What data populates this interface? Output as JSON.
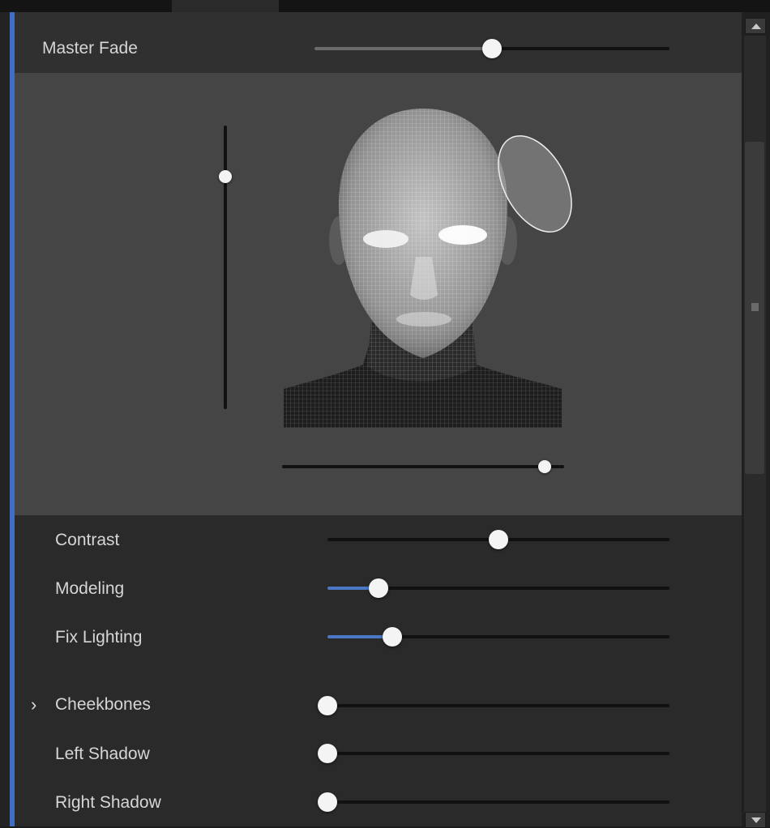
{
  "window": {
    "accent_color": "#3f6fc2"
  },
  "master_fade": {
    "label": "Master Fade",
    "value": 0.5
  },
  "viewport": {
    "image": "wireframe-head",
    "vertical_slider": {
      "value": 0.82
    },
    "horizontal_slider": {
      "value": 0.93
    }
  },
  "controls": [
    {
      "label": "Contrast",
      "value": 0.5,
      "fill_color": ""
    },
    {
      "label": "Modeling",
      "value": 0.15,
      "fill_color": "#4a78c6"
    },
    {
      "label": "Fix Lighting",
      "value": 0.19,
      "fill_color": "#4a78c6"
    },
    {
      "label": "Cheekbones",
      "value": 0.0,
      "fill_color": "",
      "expandable": true,
      "expand_icon": "chevron-right-icon",
      "expand_glyph": "›"
    },
    {
      "label": "Left Shadow",
      "value": 0.0,
      "fill_color": ""
    },
    {
      "label": "Right Shadow",
      "value": 0.0,
      "fill_color": ""
    }
  ],
  "scrollbar": {
    "up_icon": "arrow-up-icon",
    "down_icon": "arrow-down-icon"
  }
}
